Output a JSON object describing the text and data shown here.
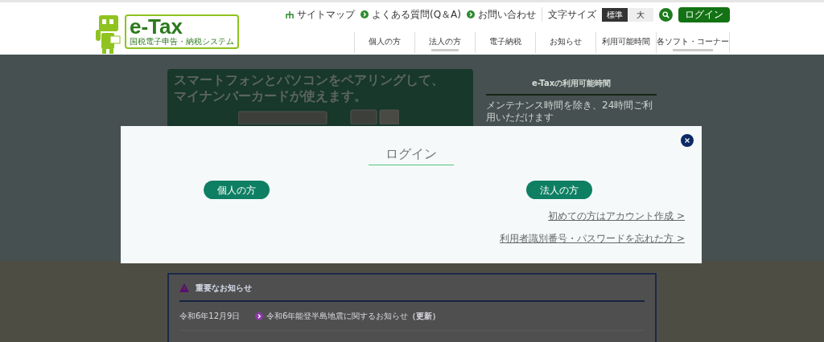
{
  "header": {
    "logo": {
      "title": "e-Tax",
      "subtitle": "国税電子申告・納税システム"
    },
    "utility_links": [
      {
        "kind": "sitemap",
        "label": "サイトマップ"
      },
      {
        "kind": "arrow",
        "label": "よくある質問(Q＆A)"
      },
      {
        "kind": "arrow",
        "label": "お問い合わせ"
      }
    ],
    "font_size": {
      "label": "文字サイズ",
      "options": [
        {
          "label": "標準",
          "selected": true
        },
        {
          "label": "大",
          "selected": false
        }
      ]
    },
    "login_button": "ログイン",
    "nav": [
      {
        "label": "個人の方",
        "selected": false
      },
      {
        "label": "法人の方",
        "selected": true
      },
      {
        "label": "電子納税",
        "selected": false
      },
      {
        "label": "お知らせ",
        "selected": false
      },
      {
        "label": "利用可能時間",
        "selected": false
      },
      {
        "label": "各ソフト・コーナー",
        "selected": true
      }
    ]
  },
  "banner": {
    "lines": [
      "スマートフォンとパソコンをペアリングして、",
      "マイナンバーカードが使えます。"
    ]
  },
  "availability": {
    "title": "e-Taxの利用可能時間",
    "text": "メンテナンス時間を除き、24時間ご利用いただけます"
  },
  "notices": {
    "title": "重要なお知らせ",
    "items": [
      {
        "date": "令和6年12月9日",
        "text": "令和6年能登半島地震に関するお知らせ**（更新）**"
      }
    ]
  },
  "modal": {
    "title": "ログイン",
    "buttons": [
      "個人の方",
      "法人の方"
    ],
    "links": [
      "初めての方はアカウント作成 >",
      "利用者識別番号・パスワードを忘れた方 >"
    ]
  }
}
